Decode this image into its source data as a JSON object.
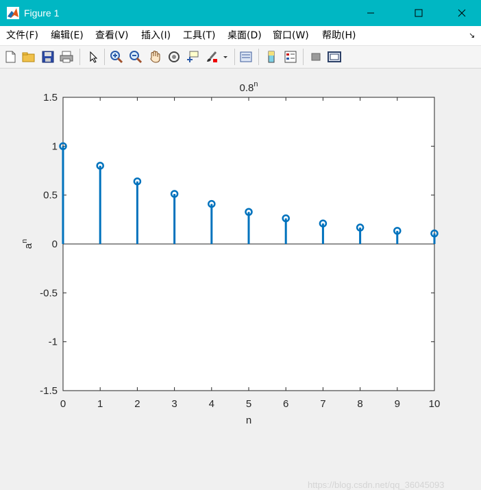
{
  "window": {
    "title": "Figure 1"
  },
  "menu": {
    "items": [
      "文件(F)",
      "编辑(E)",
      "查看(V)",
      "插入(I)",
      "工具(T)",
      "桌面(D)",
      "窗口(W)",
      "帮助(H)"
    ]
  },
  "toolbar": {
    "icons": [
      "new-file-icon",
      "open-folder-icon",
      "save-icon",
      "print-icon",
      "pointer-icon",
      "zoom-in-icon",
      "zoom-out-icon",
      "pan-hand-icon",
      "rotate-3d-icon",
      "data-cursor-icon",
      "brush-icon",
      "link-plot-icon",
      "colorbar-icon",
      "legend-icon",
      "hide-plot-tools-icon",
      "show-plot-tools-icon"
    ]
  },
  "colors": {
    "titlebar": "#00b7c3",
    "stem": "#0072bd",
    "axes_bg": "#ffffff"
  },
  "chart_data": {
    "type": "stem",
    "title": "0.8",
    "title_superscript": "n",
    "xlabel": "n",
    "ylabel": "a",
    "ylabel_superscript": "n",
    "xlim": [
      0,
      10
    ],
    "ylim": [
      -1.5,
      1.5
    ],
    "xticks": [
      "0",
      "1",
      "2",
      "3",
      "4",
      "5",
      "6",
      "7",
      "8",
      "9",
      "10"
    ],
    "yticks": [
      "1.5",
      "1",
      "0.5",
      "0",
      "-0.5",
      "-1",
      "-1.5"
    ],
    "x": [
      0,
      1,
      2,
      3,
      4,
      5,
      6,
      7,
      8,
      9,
      10
    ],
    "y": [
      1,
      0.8,
      0.64,
      0.512,
      0.4096,
      0.3277,
      0.2621,
      0.2097,
      0.1678,
      0.1342,
      0.1074
    ],
    "grid": false
  },
  "watermark": "https://blog.csdn.net/qq_36045093"
}
